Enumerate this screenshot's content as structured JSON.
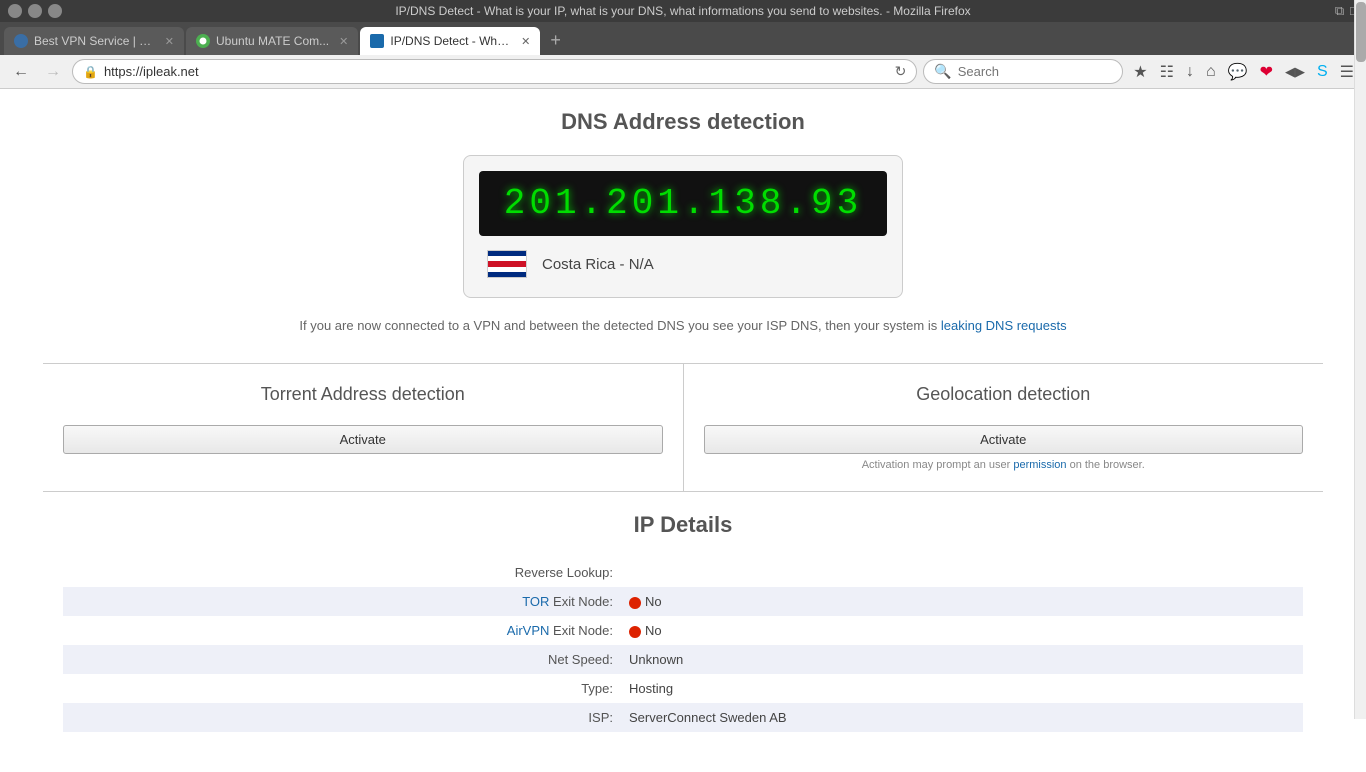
{
  "browser": {
    "title": "IP/DNS Detect - What is your IP, what is your DNS, what informations you send to websites. - Mozilla Firefox",
    "tabs": [
      {
        "id": "tab1",
        "label": "Best VPN Service | N...",
        "icon_color": "#3a6ea5",
        "active": false
      },
      {
        "id": "tab2",
        "label": "Ubuntu MATE Com...",
        "icon_color": "#4caf50",
        "active": false
      },
      {
        "id": "tab3",
        "label": "IP/DNS Detect - Wha...",
        "icon_color": "#1a6aab",
        "active": true
      }
    ],
    "address": "https://ipleak.net",
    "search_placeholder": "Search"
  },
  "dns_section": {
    "title": "DNS Address detection",
    "ip_address": "201.201.138.93",
    "country": "Costa Rica",
    "region": "N/A",
    "country_display": "Costa Rica - N/A",
    "leak_warning": "If you are now connected to a VPN and between the detected DNS you see your ISP DNS, then your system is",
    "leak_link_text": "leaking DNS requests",
    "leak_link_href": "#"
  },
  "torrent_section": {
    "title": "Torrent Address detection",
    "activate_label": "Activate"
  },
  "geolocation_section": {
    "title": "Geolocation detection",
    "activate_label": "Activate",
    "note": "Activation may prompt an user permission on the browser.",
    "note_link": "permission"
  },
  "ip_details": {
    "title": "IP Details",
    "rows": [
      {
        "label": "Reverse Lookup:",
        "value": "",
        "type": "plain",
        "highlight": false
      },
      {
        "label": "TOR Exit Node:",
        "label_link": "TOR",
        "value": "No",
        "type": "dot-red",
        "highlight": true
      },
      {
        "label": "AirVPN Exit Node:",
        "label_link": "AirVPN",
        "value": "No",
        "type": "dot-red",
        "highlight": false
      },
      {
        "label": "Net Speed:",
        "value": "Unknown",
        "type": "plain",
        "highlight": true
      },
      {
        "label": "Type:",
        "value": "Hosting",
        "type": "plain",
        "highlight": false
      },
      {
        "label": "ISP:",
        "value": "ServerConnect Sweden AB",
        "type": "plain",
        "highlight": true
      }
    ]
  }
}
